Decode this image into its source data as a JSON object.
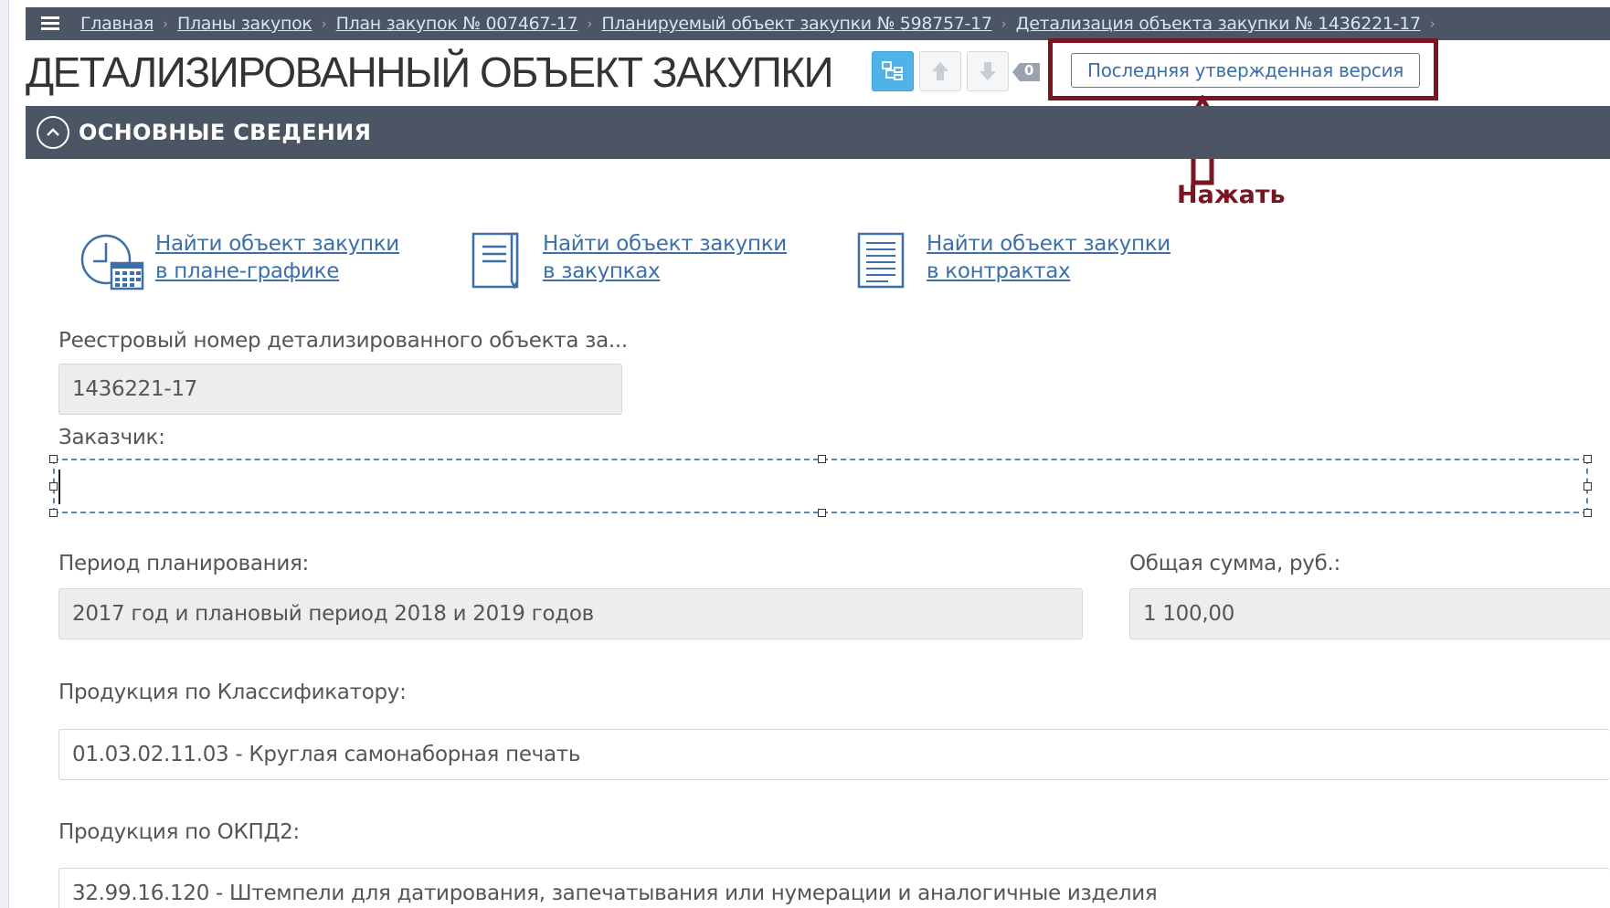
{
  "breadcrumb": [
    "Главная",
    "Планы закупок",
    "План закупок № 007467-17",
    "Планируемый объект закупки № 598757-17",
    "Детализация объекта закупки № 1436221-17"
  ],
  "page": {
    "title": "ДЕТАЛИЗИРОВАННЫЙ ОБЪЕКТ ЗАКУПКИ",
    "badge_count": "0",
    "version_button": "Последняя утвержденная версия",
    "annotation": "Нажать"
  },
  "section": {
    "title": "ОСНОВНЫЕ СВЕДЕНИЯ"
  },
  "find_links": [
    {
      "line1": "Найти объект закупки",
      "line2": "в плане-графике",
      "icon": "calendar-clock-icon"
    },
    {
      "line1": "Найти объект закупки",
      "line2": "в закупках",
      "icon": "document-pen-icon"
    },
    {
      "line1": "Найти объект закупки",
      "line2": "в контрактах",
      "icon": "document-lines-icon"
    }
  ],
  "form": {
    "registry_label": "Реестровый номер детализированного объекта за...",
    "registry_value": "1436221-17",
    "customer_label": "Заказчик:",
    "customer_value": "",
    "period_label": "Период планирования:",
    "period_value": "2017 год и плановый период 2018 и 2019 годов",
    "sum_label": "Общая сумма, руб.:",
    "sum_value": "1 100,00",
    "classifier_label": "Продукция по Классификатору:",
    "classifier_value": "01.03.02.11.03 - Круглая самонаборная печать",
    "okpd_label": "Продукция по ОКПД2:",
    "okpd_value": "32.99.16.120 - Штемпели для датирования, запечатывания или нумерации и аналогичные изделия"
  },
  "colors": {
    "header_bg": "#4b5563",
    "link": "#3d6fa8",
    "highlight": "#7b1521",
    "active_tool": "#4fb3e8"
  }
}
